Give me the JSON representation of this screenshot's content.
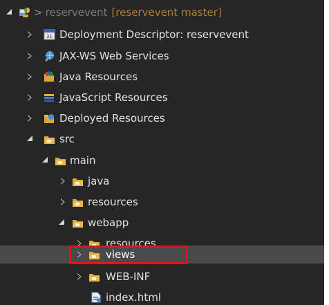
{
  "project": {
    "prefix": ">",
    "name": "reservevent",
    "branch": "[reservevent master]"
  },
  "nodes": [
    {
      "label": "Deployment Descriptor: reservevent",
      "icon": "deployment-descriptor-icon",
      "state": "collapsed"
    },
    {
      "label": "JAX-WS Web Services",
      "icon": "web-services-icon",
      "state": "collapsed"
    },
    {
      "label": "Java Resources",
      "icon": "java-resources-icon",
      "state": "collapsed"
    },
    {
      "label": "JavaScript Resources",
      "icon": "javascript-resources-icon",
      "state": "collapsed"
    },
    {
      "label": "Deployed Resources",
      "icon": "deployed-resources-icon",
      "state": "collapsed"
    },
    {
      "label": "src",
      "icon": "folder-icon",
      "state": "expanded"
    },
    {
      "label": "main",
      "icon": "folder-icon",
      "state": "expanded"
    },
    {
      "label": "java",
      "icon": "folder-icon",
      "state": "collapsed"
    },
    {
      "label": "resources",
      "icon": "folder-icon",
      "state": "collapsed"
    },
    {
      "label": "webapp",
      "icon": "folder-icon",
      "state": "expanded"
    },
    {
      "label": "resources",
      "icon": "folder-icon",
      "state": "collapsed"
    },
    {
      "label": "views",
      "icon": "folder-icon",
      "state": "collapsed",
      "selected": true
    },
    {
      "label": "WEB-INF",
      "icon": "folder-icon",
      "state": "collapsed"
    },
    {
      "label": "index.html",
      "icon": "html-file-icon",
      "state": "leaf"
    }
  ],
  "colors": {
    "background": "#262626",
    "text": "#e2e2e2",
    "project_name": "#7a7a7a",
    "project_tag": "#b07d3c",
    "highlight_border": "#e0141b",
    "selected_row": "#4a4a4a"
  }
}
